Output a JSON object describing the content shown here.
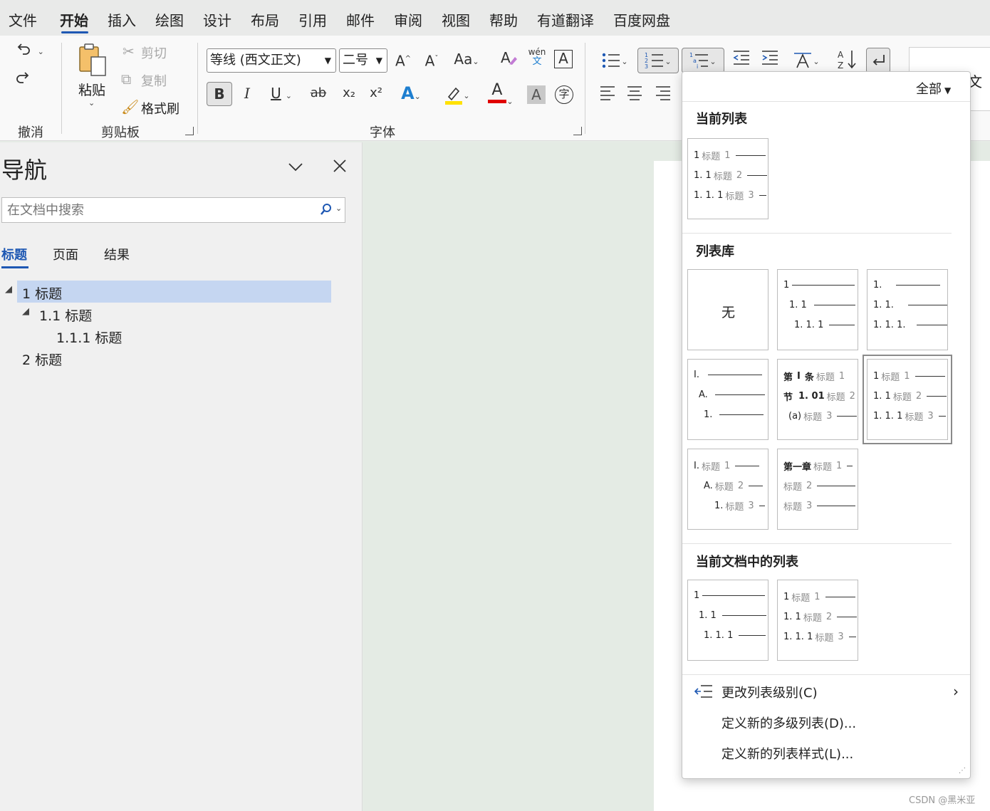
{
  "tabs": [
    "文件",
    "开始",
    "插入",
    "绘图",
    "设计",
    "布局",
    "引用",
    "邮件",
    "审阅",
    "视图",
    "帮助",
    "有道翻译",
    "百度网盘"
  ],
  "active_tab": "开始",
  "ribbon": {
    "undo_group": "撤消",
    "clipboard": {
      "group": "剪贴板",
      "paste": "粘贴",
      "cut": "剪切",
      "copy": "复制",
      "format_painter": "格式刷"
    },
    "font": {
      "group": "字体",
      "font_name": "等线 (西文正文)",
      "font_size": "二号",
      "bold": "B",
      "italic": "I",
      "underline": "U",
      "strike": "ab",
      "subscript": "x₂",
      "superscript": "x²",
      "change_case": "Aa",
      "grow": "A",
      "shrink": "A",
      "text_effect": "A",
      "font_color": "A",
      "char_shading": "A",
      "enclose": "字",
      "phonetic_top": "wén",
      "phonetic_bottom": "文",
      "char_border": "A"
    },
    "paragraph": {
      "sort": "A↓Z"
    },
    "right_label": "二文",
    "colors": {
      "highlight": "#ffe100",
      "font_color": "#e00000",
      "accent": "#1e58b3"
    }
  },
  "nav": {
    "title": "导航",
    "search_placeholder": "在文档中搜索",
    "tabs": [
      "标题",
      "页面",
      "结果"
    ],
    "active_tab": "标题",
    "tree": [
      {
        "label": "1 标题",
        "selected": true
      },
      {
        "label": "1.1 标题"
      },
      {
        "label": "1.1.1 标题"
      },
      {
        "label": "2 标题"
      }
    ]
  },
  "menu": {
    "filter": "全部",
    "sections": {
      "current": "当前列表",
      "library": "列表库",
      "in_doc": "当前文档中的列表"
    },
    "none_label": "无",
    "actions": [
      "更改列表级别(C)",
      "定义新的多级列表(D)...",
      "定义新的列表样式(L)..."
    ],
    "word_heading": "标题",
    "tile_texts": {
      "current": {
        "l1": "1",
        "l2": "1. 1",
        "l3": "1. 1. 1",
        "n1": "1",
        "n2": "2",
        "n3": "3"
      },
      "lib2": {
        "l1": "1",
        "l2": "1. 1",
        "l3": "1. 1. 1"
      },
      "lib3": {
        "l1": "1.",
        "l2": "1. 1.",
        "l3": "1. 1. 1."
      },
      "lib4": {
        "l1": "I.",
        "l2": "A.",
        "l3": "1."
      },
      "lib5": {
        "l1a": "第",
        "l1b": "I",
        "l1c": "条",
        "l2a": "节",
        "l2b": "1. 01",
        "l3": "(a)",
        "n1": "1",
        "n2": "2",
        "n3": "3"
      },
      "lib6": {
        "l1": "1",
        "l2": "1. 1",
        "l3": "1. 1. 1",
        "n1": "1",
        "n2": "2",
        "n3": "3"
      },
      "lib7": {
        "l1": "I.",
        "l2": "A.",
        "l3": "1.",
        "n1": "1",
        "n2": "2",
        "n3": "3"
      },
      "lib8": {
        "l1": "第一章",
        "n1": "1",
        "n2": "2",
        "n3": "3"
      },
      "doc1": {
        "l1": "1",
        "l2": "1. 1",
        "l3": "1. 1. 1"
      },
      "doc2": {
        "l1": "1",
        "l2": "1. 1",
        "l3": "1. 1. 1",
        "n1": "1",
        "n2": "2",
        "n3": "3"
      }
    }
  },
  "watermark": "CSDN @黑米亚"
}
